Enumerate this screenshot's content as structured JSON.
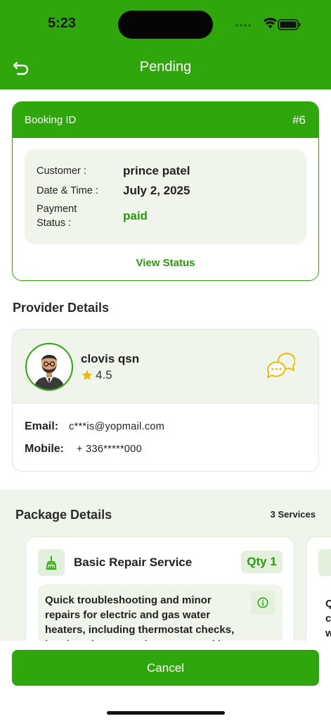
{
  "status_bar": {
    "time": "5:23"
  },
  "header": {
    "title": "Pending"
  },
  "booking": {
    "id_label": "Booking ID",
    "id_value": "#6",
    "customer_label": "Customer :",
    "customer_value": "prince patel",
    "datetime_label": "Date & Time :",
    "datetime_value": "July 2, 2025",
    "payment_label_line1": "Payment",
    "payment_label_line2": "Status :",
    "payment_value": "paid",
    "view_status": "View Status"
  },
  "provider": {
    "section_title": "Provider Details",
    "name": "clovis qsn",
    "rating": "4.5",
    "email_label": "Email:",
    "email_value": "c***is@yopmail.com",
    "mobile_label": "Mobile:",
    "mobile_value": "+ 336*****000"
  },
  "package": {
    "section_title": "Package Details",
    "services_count": "3 Services",
    "items": [
      {
        "name": "Basic Repair Service",
        "qty": "Qty 1",
        "description": "Quick troubleshooting and minor repairs for electric and gas water heaters, including thermostat checks, heating element replacement, and le"
      }
    ],
    "next_card_text": "Q\nc\nw"
  },
  "actions": {
    "cancel_label": "Cancel"
  },
  "colors": {
    "primary": "#2ea60c",
    "panel": "#eff5eb",
    "accent_text": "#2a9a0d",
    "star": "#f2b705",
    "chat": "#f2b705"
  }
}
